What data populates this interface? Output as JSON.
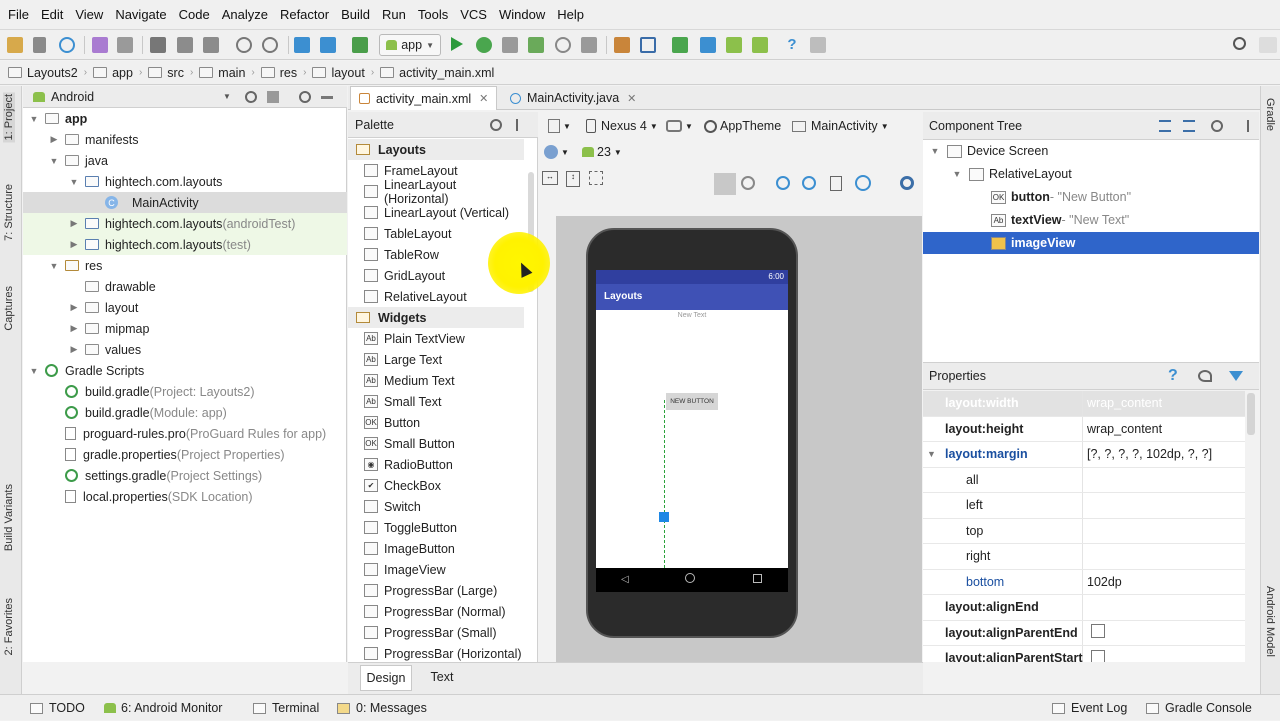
{
  "menu": [
    "File",
    "Edit",
    "View",
    "Navigate",
    "Code",
    "Analyze",
    "Refactor",
    "Build",
    "Run",
    "Tools",
    "VCS",
    "Window",
    "Help"
  ],
  "toolbar": {
    "run_config": "app"
  },
  "breadcrumbs": [
    "Layouts2",
    "app",
    "src",
    "main",
    "res",
    "layout",
    "activity_main.xml"
  ],
  "left_strip": {
    "project": "1: Project",
    "structure": "7: Structure",
    "captures": "Captures",
    "build_variants": "Build Variants",
    "favorites": "2: Favorites"
  },
  "right_strip": {
    "gradle": "Gradle",
    "android_model": "Android Model"
  },
  "project_panel": {
    "view_mode": "Android"
  },
  "tree": [
    {
      "label": "app",
      "suffix": "",
      "indent": 0,
      "arrow": "▼",
      "icon": "module",
      "bold": true
    },
    {
      "label": "manifests",
      "suffix": "",
      "indent": 1,
      "arrow": "▶",
      "icon": "folder"
    },
    {
      "label": "java",
      "suffix": "",
      "indent": 1,
      "arrow": "▼",
      "icon": "folder"
    },
    {
      "label": "hightech.com.layouts",
      "suffix": "",
      "indent": 2,
      "arrow": "▼",
      "icon": "package"
    },
    {
      "label": "MainActivity",
      "suffix": "",
      "indent": 3,
      "arrow": "",
      "icon": "class",
      "selected": true
    },
    {
      "label": "hightech.com.layouts",
      "suffix": " (androidTest)",
      "indent": 2,
      "arrow": "▶",
      "icon": "package",
      "tint": true
    },
    {
      "label": "hightech.com.layouts",
      "suffix": " (test)",
      "indent": 2,
      "arrow": "▶",
      "icon": "package",
      "tint": true
    },
    {
      "label": "res",
      "suffix": "",
      "indent": 1,
      "arrow": "▼",
      "icon": "res"
    },
    {
      "label": "drawable",
      "suffix": "",
      "indent": 2,
      "arrow": "",
      "icon": "folder"
    },
    {
      "label": "layout",
      "suffix": "",
      "indent": 2,
      "arrow": "▶",
      "icon": "folder"
    },
    {
      "label": "mipmap",
      "suffix": "",
      "indent": 2,
      "arrow": "▶",
      "icon": "folder"
    },
    {
      "label": "values",
      "suffix": "",
      "indent": 2,
      "arrow": "▶",
      "icon": "folder"
    },
    {
      "label": "Gradle Scripts",
      "suffix": "",
      "indent": 0,
      "arrow": "▼",
      "icon": "gradle"
    },
    {
      "label": "build.gradle",
      "suffix": " (Project: Layouts2)",
      "indent": 1,
      "arrow": "",
      "icon": "gradle"
    },
    {
      "label": "build.gradle",
      "suffix": " (Module: app)",
      "indent": 1,
      "arrow": "",
      "icon": "gradle"
    },
    {
      "label": "proguard-rules.pro",
      "suffix": " (ProGuard Rules for app)",
      "indent": 1,
      "arrow": "",
      "icon": "file"
    },
    {
      "label": "gradle.properties",
      "suffix": " (Project Properties)",
      "indent": 1,
      "arrow": "",
      "icon": "file"
    },
    {
      "label": "settings.gradle",
      "suffix": " (Project Settings)",
      "indent": 1,
      "arrow": "",
      "icon": "gradle"
    },
    {
      "label": "local.properties",
      "suffix": " (SDK Location)",
      "indent": 1,
      "arrow": "",
      "icon": "file"
    }
  ],
  "editor_tabs": [
    {
      "label": "activity_main.xml",
      "active": true
    },
    {
      "label": "MainActivity.java",
      "active": false
    }
  ],
  "palette": {
    "title": "Palette",
    "items": [
      {
        "label": "Layouts",
        "group": true
      },
      {
        "label": "FrameLayout",
        "icon": ""
      },
      {
        "label": "LinearLayout (Horizontal)",
        "icon": ""
      },
      {
        "label": "LinearLayout (Vertical)",
        "icon": ""
      },
      {
        "label": "TableLayout",
        "icon": ""
      },
      {
        "label": "TableRow",
        "icon": ""
      },
      {
        "label": "GridLayout",
        "icon": ""
      },
      {
        "label": "RelativeLayout",
        "icon": ""
      },
      {
        "label": "Widgets",
        "group": true
      },
      {
        "label": "Plain TextView",
        "icon": "Ab"
      },
      {
        "label": "Large Text",
        "icon": "Ab"
      },
      {
        "label": "Medium Text",
        "icon": "Ab"
      },
      {
        "label": "Small Text",
        "icon": "Ab"
      },
      {
        "label": "Button",
        "icon": "OK"
      },
      {
        "label": "Small Button",
        "icon": "OK"
      },
      {
        "label": "RadioButton",
        "icon": "◉"
      },
      {
        "label": "CheckBox",
        "icon": "✔"
      },
      {
        "label": "Switch",
        "icon": ""
      },
      {
        "label": "ToggleButton",
        "icon": ""
      },
      {
        "label": "ImageButton",
        "icon": ""
      },
      {
        "label": "ImageView",
        "icon": ""
      },
      {
        "label": "ProgressBar (Large)",
        "icon": ""
      },
      {
        "label": "ProgressBar (Normal)",
        "icon": ""
      },
      {
        "label": "ProgressBar (Small)",
        "icon": ""
      },
      {
        "label": "ProgressBar (Horizontal)",
        "icon": ""
      }
    ]
  },
  "designer": {
    "device": "Nexus 4",
    "theme": "AppTheme",
    "activity": "MainActivity",
    "api": "23"
  },
  "phone": {
    "time": "6:00",
    "app_title": "Layouts",
    "text": "New Text",
    "button": "NEW BUTTON"
  },
  "component_tree": {
    "title": "Component Tree",
    "rows": [
      {
        "label": "Device Screen",
        "extra": "",
        "indent": 0,
        "arrow": "▼"
      },
      {
        "label": "RelativeLayout",
        "extra": "",
        "indent": 1,
        "arrow": "▼"
      },
      {
        "label": "button",
        "extra": " - \"New Button\"",
        "indent": 2,
        "arrow": "",
        "icon": "OK"
      },
      {
        "label": "textView",
        "extra": " - \"New Text\"",
        "indent": 2,
        "arrow": "",
        "icon": "Ab"
      },
      {
        "label": "imageView",
        "extra": "",
        "indent": 2,
        "arrow": "",
        "icon": "img",
        "selected": true
      }
    ]
  },
  "properties": {
    "title": "Properties",
    "rows": [
      {
        "name": "layout:width",
        "value": "wrap_content",
        "dim": true
      },
      {
        "name": "layout:height",
        "value": "wrap_content"
      },
      {
        "name": "layout:margin",
        "value": "[?, ?, ?, ?, 102dp, ?, ?]",
        "arrow": "▼",
        "blue": true
      },
      {
        "name": "all",
        "value": "",
        "sub": true
      },
      {
        "name": "left",
        "value": "",
        "sub": true
      },
      {
        "name": "top",
        "value": "",
        "sub": true
      },
      {
        "name": "right",
        "value": "",
        "sub": true
      },
      {
        "name": "bottom",
        "value": "102dp",
        "sub": true,
        "blue": true
      },
      {
        "name": "layout:alignEnd",
        "value": ""
      },
      {
        "name": "layout:alignParentEnd",
        "value": "",
        "checkbox": true
      },
      {
        "name": "layout:alignParentStart",
        "value": "",
        "checkbox": true
      }
    ]
  },
  "bottom_tabs": {
    "design": "Design",
    "text": "Text"
  },
  "status": {
    "todo": "TODO",
    "monitor": "6: Android Monitor",
    "terminal": "Terminal",
    "messages": "0: Messages",
    "event_log": "Event Log",
    "gradle_console": "Gradle Console"
  }
}
